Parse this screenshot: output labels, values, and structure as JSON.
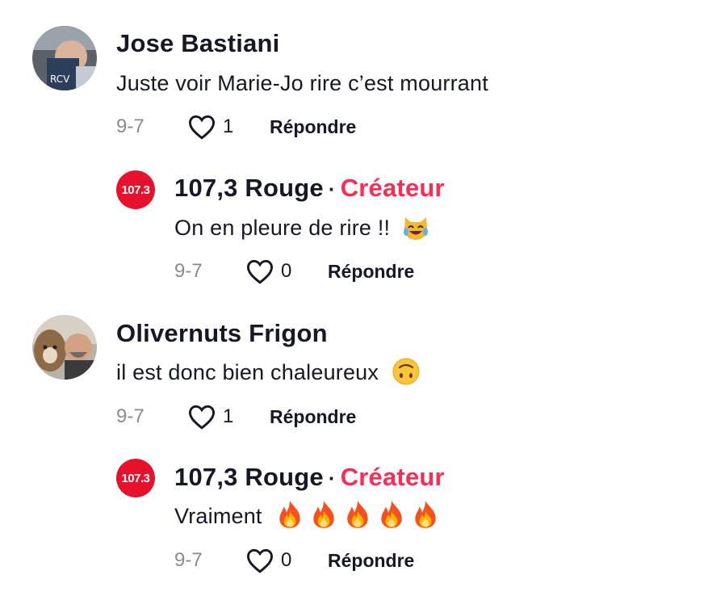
{
  "comments": [
    {
      "username": "Jose Bastiani",
      "text": "Juste voir Marie-Jo rire c’est mourrant",
      "date": "9-7",
      "likes": "1",
      "reply_label": "Répondre",
      "reply": {
        "logo_text": "107.3",
        "username": "107,3 Rouge",
        "separator": "·",
        "badge": "Créateur",
        "text": "On en pleure de rire !!",
        "emoji_icon": "cat-tears-of-joy-icon",
        "date": "9-7",
        "likes": "0",
        "reply_label": "Répondre"
      }
    },
    {
      "username": "Olivernuts Frigon",
      "text": "il est donc bien chaleureux",
      "emoji_icon": "upside-down-face-icon",
      "date": "9-7",
      "likes": "1",
      "reply_label": "Répondre",
      "reply": {
        "logo_text": "107.3",
        "username": "107,3 Rouge",
        "separator": "·",
        "badge": "Créateur",
        "text": "Vraiment",
        "emoji_icon": "fire-icon",
        "emoji_count": 5,
        "date": "9-7",
        "likes": "0",
        "reply_label": "Répondre"
      }
    }
  ],
  "colors": {
    "creator_badge": "#fe2c55",
    "brand_logo": "#e8112d",
    "meta_gray": "#8a8b91",
    "text": "#161823"
  }
}
